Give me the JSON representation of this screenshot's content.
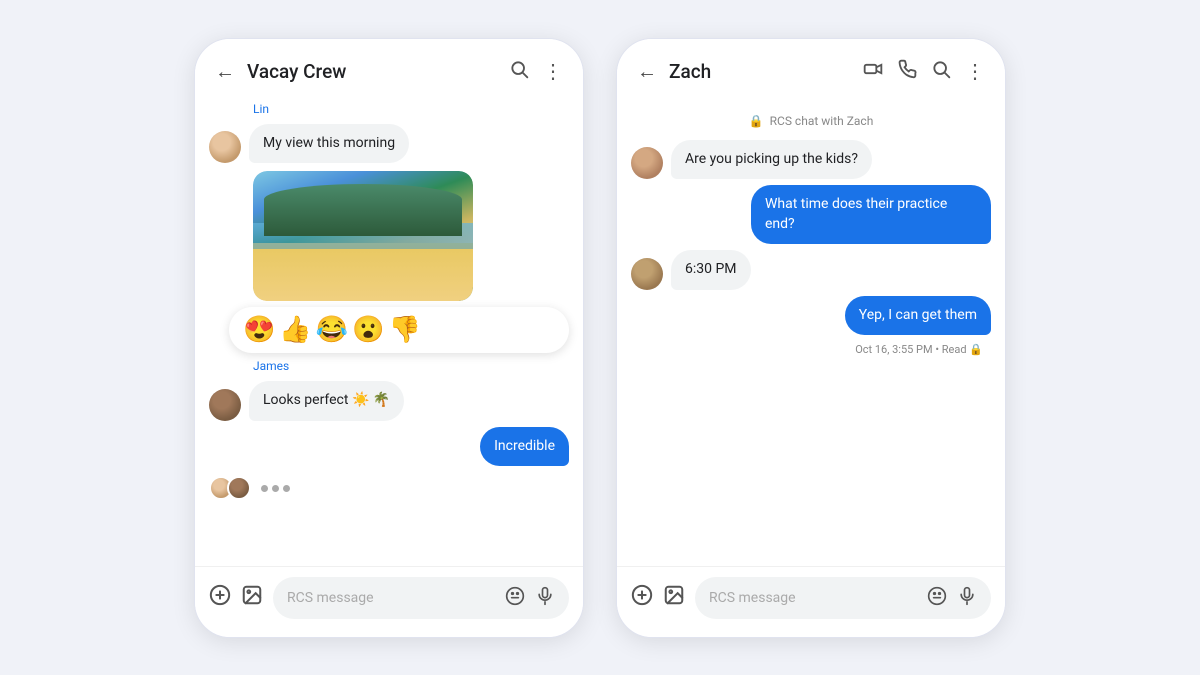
{
  "phone1": {
    "header": {
      "back_label": "←",
      "title": "Vacay Crew",
      "search_icon": "search",
      "more_icon": "⋮"
    },
    "messages": [
      {
        "id": "lin_label",
        "sender": "Lin",
        "type": "label"
      },
      {
        "id": "lin_msg",
        "text": "My view this morning",
        "type": "received"
      },
      {
        "id": "lin_img",
        "type": "image"
      },
      {
        "id": "reactions",
        "type": "reactions",
        "emojis": [
          "😍",
          "👍",
          "😂",
          "😮",
          "👎"
        ]
      },
      {
        "id": "james_label",
        "sender": "James",
        "type": "label"
      },
      {
        "id": "james_msg",
        "text": "Looks perfect ☀️ 🌴",
        "type": "received"
      },
      {
        "id": "sent_msg",
        "text": "Incredible",
        "type": "sent"
      },
      {
        "id": "typing",
        "type": "typing"
      }
    ],
    "footer": {
      "plus_icon": "⊕",
      "gallery_icon": "🖼",
      "placeholder": "RCS message",
      "emoji_icon": "☺",
      "mic_icon": "🎤"
    }
  },
  "phone2": {
    "header": {
      "back_label": "←",
      "title": "Zach",
      "video_icon": "📹",
      "phone_icon": "📞",
      "search_icon": "🔍",
      "more_icon": "⋮"
    },
    "rcs_info": "RCS chat with Zach",
    "messages": [
      {
        "id": "zach_q1",
        "text": "Are you picking up the kids?",
        "type": "received"
      },
      {
        "id": "sent_q1",
        "text": "What time does their practice end?",
        "type": "sent"
      },
      {
        "id": "zach_a1",
        "text": "6:30 PM",
        "type": "received"
      },
      {
        "id": "sent_a1",
        "text": "Yep, I can get them",
        "type": "sent"
      }
    ],
    "status": "Oct 16, 3:55 PM • Read 🔒",
    "footer": {
      "plus_icon": "⊕",
      "gallery_icon": "🖼",
      "placeholder": "RCS message",
      "emoji_icon": "☺",
      "mic_icon": "🎤"
    }
  }
}
